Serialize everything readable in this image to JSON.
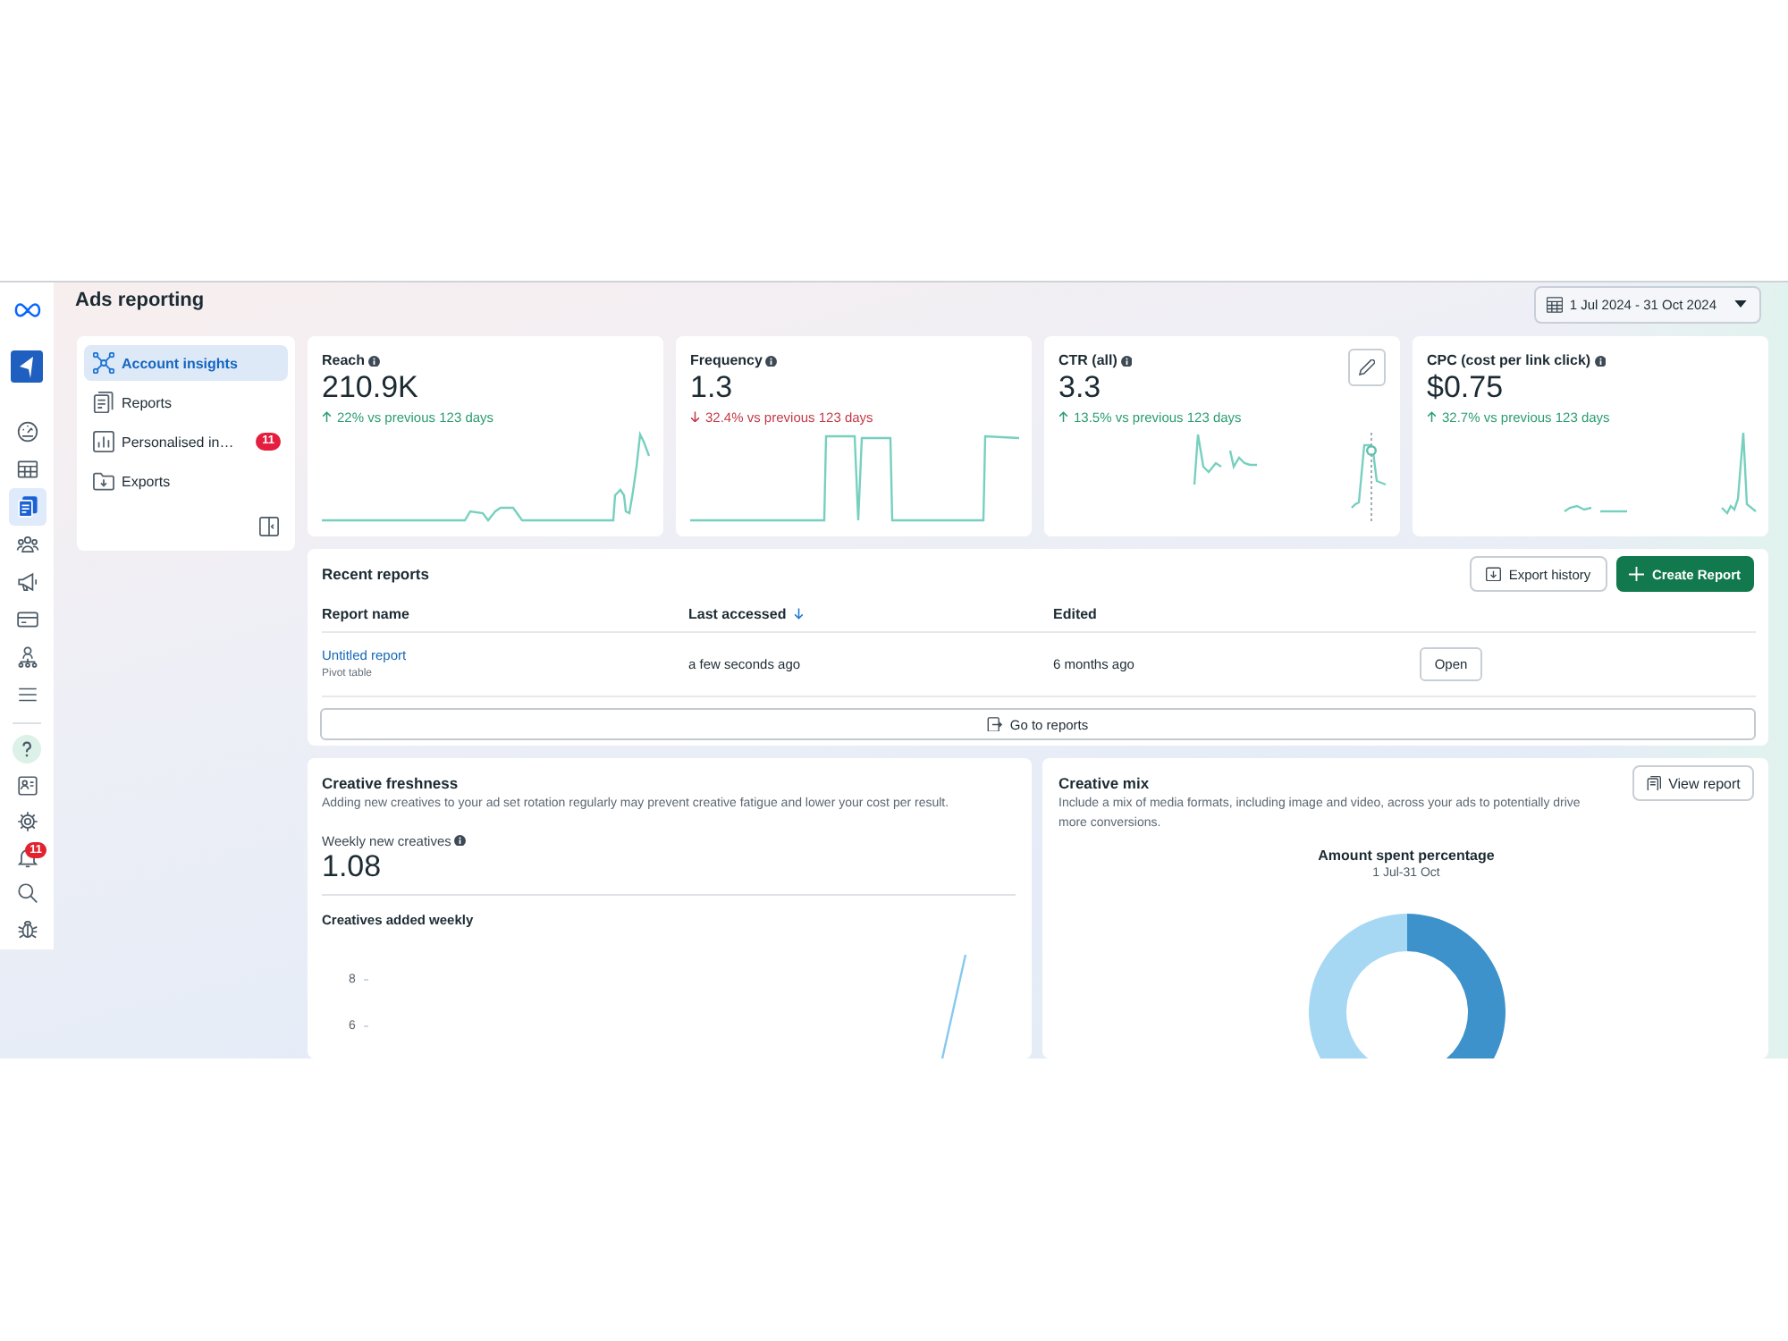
{
  "nav_rail": {
    "top": [
      {
        "kind": "gauge",
        "selected": false
      },
      {
        "kind": "table",
        "selected": false
      },
      {
        "kind": "documents",
        "selected": true
      },
      {
        "kind": "people",
        "selected": false
      },
      {
        "kind": "megaphone",
        "selected": false
      },
      {
        "kind": "card",
        "selected": false
      },
      {
        "kind": "orgchart",
        "selected": false
      },
      {
        "kind": "menu",
        "selected": false
      }
    ],
    "bottom": [
      {
        "kind": "help",
        "selected": false
      },
      {
        "kind": "idcard",
        "selected": false
      },
      {
        "kind": "gear",
        "selected": false
      },
      {
        "kind": "bell",
        "selected": false,
        "badge": "11"
      },
      {
        "kind": "search",
        "selected": false
      },
      {
        "kind": "bug",
        "selected": false
      }
    ]
  },
  "header": {
    "title": "Ads reporting",
    "date_range": "1 Jul 2024 - 31 Oct 2024"
  },
  "sidebar": {
    "items": [
      {
        "label": "Account insights",
        "kind": "network",
        "selected": true
      },
      {
        "label": "Reports",
        "kind": "document",
        "selected": false
      },
      {
        "label": "Personalised in…",
        "kind": "chart",
        "selected": false,
        "badge": "11"
      },
      {
        "label": "Exports",
        "kind": "folder",
        "selected": false
      }
    ]
  },
  "metrics": [
    {
      "label": "Reach",
      "value": "210.9K",
      "change": "22% vs previous 123 days",
      "increase": true,
      "hovered": false
    },
    {
      "label": "Frequency",
      "value": "1.3",
      "change": "32.4% vs previous 123 days",
      "increase": false,
      "hovered": false
    },
    {
      "label": "CTR (all)",
      "value": "3.3",
      "change": "13.5% vs previous 123 days",
      "increase": true,
      "hovered": true
    },
    {
      "label": "CPC (cost per link click)",
      "value": "$0.75",
      "change": "32.7% vs previous 123 days",
      "increase": true,
      "hovered": false
    }
  ],
  "recent_reports": {
    "title": "Recent reports",
    "buttons": [
      {
        "label": "Export history",
        "kind": "export"
      },
      {
        "label": "Create Report",
        "kind": "create"
      }
    ],
    "columns": [
      {
        "label": "Report name",
        "sorted": false
      },
      {
        "label": "Last accessed",
        "sorted": true
      },
      {
        "label": "Edited",
        "sorted": false
      }
    ],
    "rows": [
      {
        "name": "Untitled report",
        "type": "Pivot table",
        "last_accessed": "a few seconds ago",
        "edited": "6 months ago",
        "action": "Open"
      }
    ],
    "footer_button": "Go to reports"
  },
  "creative_freshness": {
    "title": "Creative freshness",
    "description": "Adding new creatives to your ad set rotation regularly may prevent creative fatigue and lower your cost per result.",
    "metric_label": "Weekly new creatives",
    "metric_value": "1.08",
    "chart_title": "Creatives added weekly",
    "y_tick_labels": [
      "8",
      "6"
    ]
  },
  "creative_mix": {
    "title": "Creative mix",
    "description": "Include a mix of media formats, including image and video, across your ads to potentially drive more conversions.",
    "button": "View report",
    "chart_title": "Amount spent percentage",
    "chart_subtitle": "1 Jul-31 Oct"
  }
}
